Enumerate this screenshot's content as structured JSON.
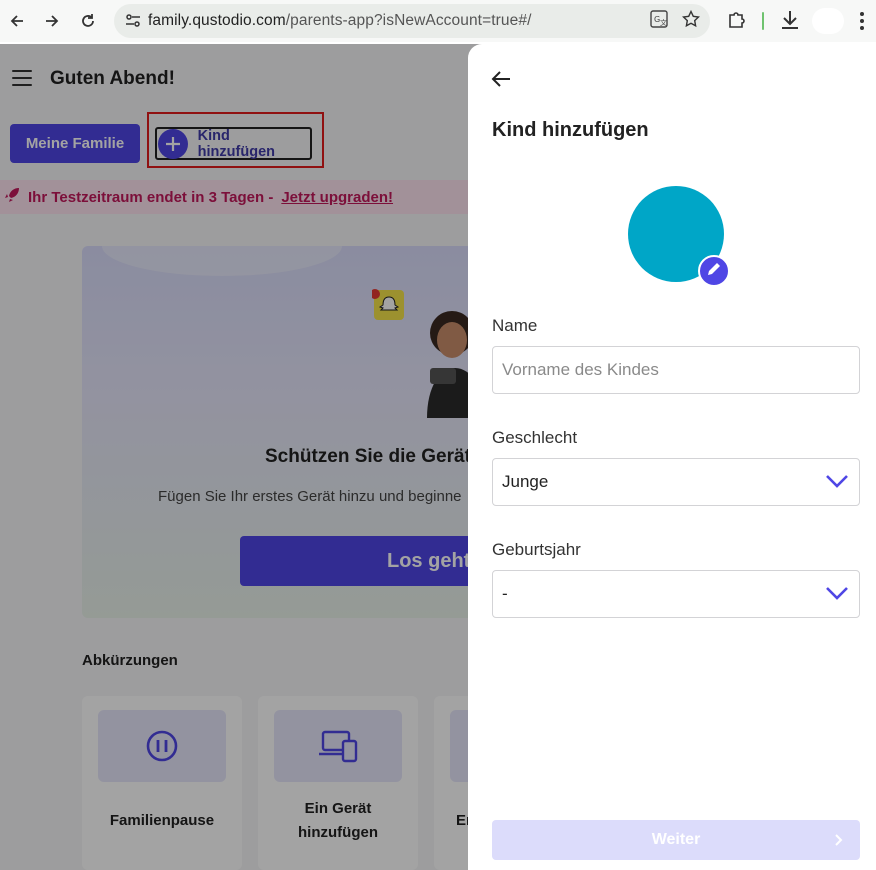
{
  "browser": {
    "url_host": "family.qustodio.com",
    "url_path": "/parents-app?isNewAccount=true#/",
    "icons": [
      "back-icon",
      "forward-icon",
      "reload-icon",
      "site-info-icon",
      "translate-icon",
      "star-icon",
      "extensions-icon",
      "download-icon",
      "profile-avatar",
      "kebab-menu-icon"
    ]
  },
  "header": {
    "greeting": "Guten Abend!",
    "family_button": "Meine Familie",
    "add_child_button": "Kind hinzufügen"
  },
  "trial_banner": {
    "text": "Ihr Testzeitraum endet in 3 Tagen -",
    "link": "Jetzt upgraden!"
  },
  "promo_card": {
    "title": "Schützen Sie die Gerät",
    "subtitle": "Fügen Sie Ihr erstes Gerät hinzu und beginne",
    "button": "Los geht's"
  },
  "shortcuts": {
    "title": "Abkürzungen",
    "items": [
      {
        "label": "Familienpause",
        "icon": "pause-icon"
      },
      {
        "label": "Ein Gerät",
        "label2": "hinzufügen",
        "icon": "devices-icon"
      },
      {
        "label": "Er",
        "icon": "partial-icon"
      }
    ]
  },
  "drawer": {
    "title": "Kind hinzufügen",
    "avatar_color": "#00a6c7",
    "name_label": "Name",
    "name_placeholder": "Vorname des Kindes",
    "gender_label": "Geschlecht",
    "gender_value": "Junge",
    "birthyear_label": "Geburtsjahr",
    "birthyear_value": "-",
    "next_button": "Weiter"
  },
  "colors": {
    "primary": "#4f46e5",
    "highlight_box": "#e21b1b",
    "trial_text": "#c2185b"
  }
}
